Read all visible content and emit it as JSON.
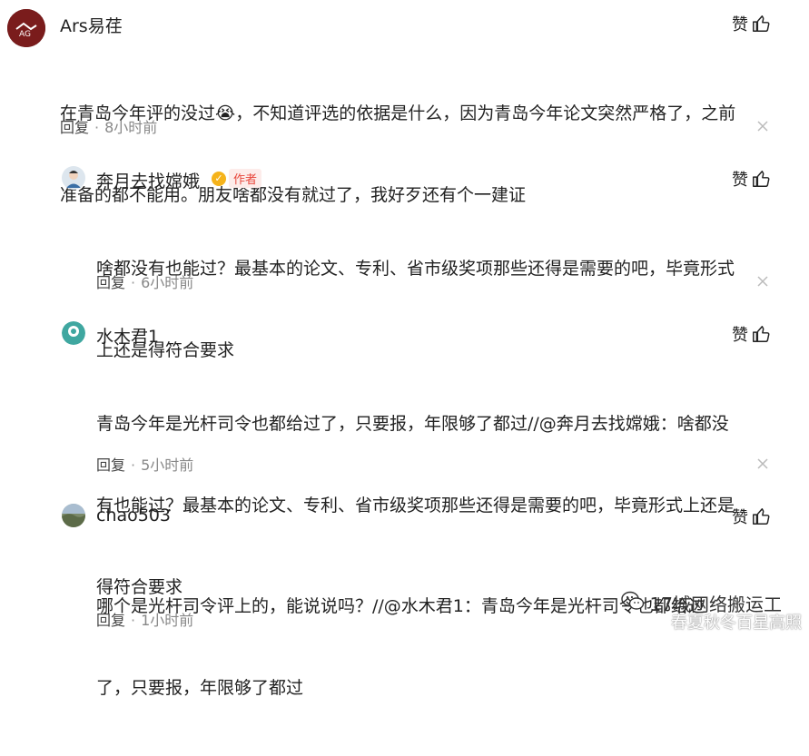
{
  "comments": [
    {
      "username": "Ars易荏",
      "like_label": "赞",
      "content_line1": "在青岛今年评的没过😭，不知道评选的依据是什么，因为青岛今年论文突然严格了，之前",
      "content_line2": "准备的都不能用。朋友啥都没有就过了，我好歹还有个一建证",
      "reply_label": "回复",
      "time": "8小时前"
    },
    {
      "username": "奔月去找嫦娥",
      "author_tag": "作者",
      "like_label": "赞",
      "content_line1": "啥都没有也能过？最基本的论文、专利、省市级奖项那些还得是需要的吧，毕竟形式",
      "content_line2": "上还是得符合要求",
      "reply_label": "回复",
      "time": "6小时前"
    },
    {
      "username": "水木君1",
      "like_label": "赞",
      "content_line1": "青岛今年是光杆司令也都给过了，只要报，年限够了都过//@奔月去找嫦娥：啥都没",
      "content_line2": "有也能过？最基本的论文、专利、省市级奖项那些还得是需要的吧，毕竟形式上还是",
      "content_line3": "得符合要求",
      "reply_label": "回复",
      "time": "5小时前"
    },
    {
      "username": "chao503",
      "like_label": "赞",
      "content_line1": "哪个是光杆司令评上的，能说说吗？//@水木君1：青岛今年是光杆司令也都给过",
      "content_line2": "了，只要报，年限够了都过",
      "reply_label": "回复",
      "time": "1小时前"
    }
  ],
  "watermark": {
    "line1": "17城网络搬运工",
    "line2": "春夏秋冬百星高照"
  },
  "colors": {
    "author_tag": "#e8473c",
    "verify_badge": "#f5b31b"
  }
}
